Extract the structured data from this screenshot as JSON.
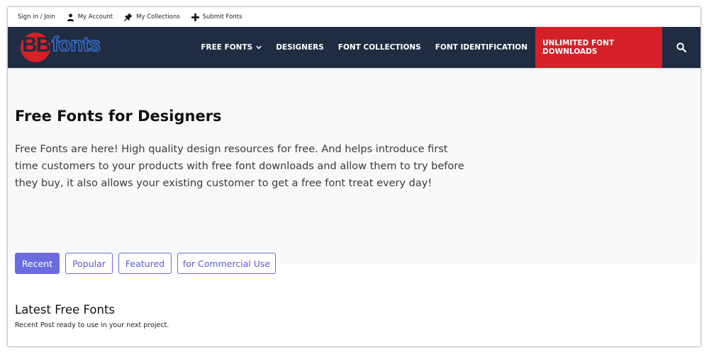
{
  "topbar": {
    "links": [
      {
        "label": "Sign in / Join"
      },
      {
        "label": "My Account",
        "icon": "user-icon"
      },
      {
        "label": "My Collections",
        "icon": "pin-icon"
      },
      {
        "label": "Submit Fonts",
        "icon": "plus-icon"
      }
    ]
  },
  "nav": {
    "logo_prefix": "BB",
    "logo_suffix": "fonts",
    "items": [
      {
        "label": "FREE FONTS"
      },
      {
        "label": "DESIGNERS"
      },
      {
        "label": "FONT COLLECTIONS"
      },
      {
        "label": "FONT IDENTIFICATION"
      }
    ],
    "cta_label": "UNLIMITED FONT DOWNLOADS",
    "search_icon": "search-icon"
  },
  "hero": {
    "title": "Free Fonts for Designers",
    "description": "Free Fonts are here! High quality design resources for free. And helps introduce first time customers to your products with free font downloads and allow them to try before they buy, it also allows your existing customer to get a free font treat every day!"
  },
  "tabs": [
    {
      "label": "Recent",
      "active": true
    },
    {
      "label": "Popular",
      "active": false
    },
    {
      "label": "Featured",
      "active": false
    },
    {
      "label": "for Commercial Use",
      "active": false
    }
  ],
  "latest": {
    "title": "Latest Free Fonts",
    "subtitle": "Recent Post ready to use in your next project."
  },
  "colors": {
    "nav_bg": "#1f2c42",
    "cta_bg": "#d62027",
    "accent": "#6c6be0",
    "hero_bg": "#f8f9fa"
  }
}
